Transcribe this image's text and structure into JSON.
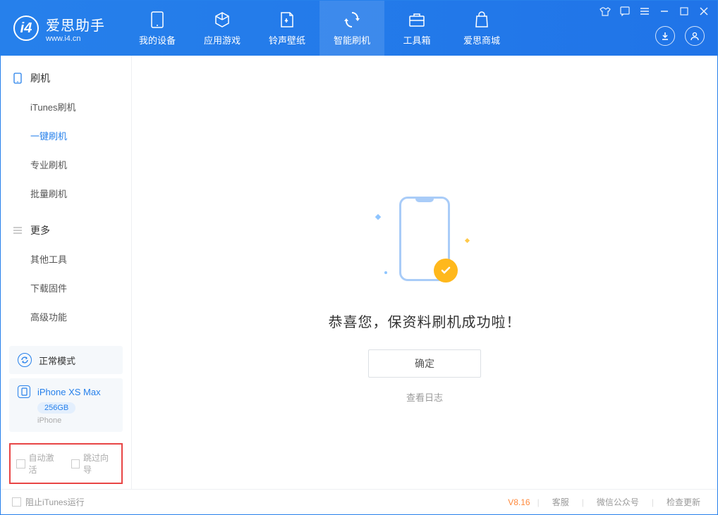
{
  "app": {
    "title": "爱思助手",
    "subtitle": "www.i4.cn"
  },
  "nav": [
    {
      "label": "我的设备"
    },
    {
      "label": "应用游戏"
    },
    {
      "label": "铃声壁纸"
    },
    {
      "label": "智能刷机"
    },
    {
      "label": "工具箱"
    },
    {
      "label": "爱思商城"
    }
  ],
  "sidebar": {
    "section1": {
      "title": "刷机",
      "items": [
        "iTunes刷机",
        "一键刷机",
        "专业刷机",
        "批量刷机"
      ]
    },
    "section2": {
      "title": "更多",
      "items": [
        "其他工具",
        "下载固件",
        "高级功能"
      ]
    }
  },
  "mode": {
    "label": "正常模式"
  },
  "device": {
    "name": "iPhone XS Max",
    "storage": "256GB",
    "type": "iPhone"
  },
  "options": {
    "auto_activate": "自动激活",
    "skip_guide": "跳过向导"
  },
  "main": {
    "success_text": "恭喜您，保资料刷机成功啦！",
    "confirm": "确定",
    "view_log": "查看日志"
  },
  "footer": {
    "block_itunes": "阻止iTunes运行",
    "version": "V8.16",
    "links": [
      "客服",
      "微信公众号",
      "检查更新"
    ]
  }
}
